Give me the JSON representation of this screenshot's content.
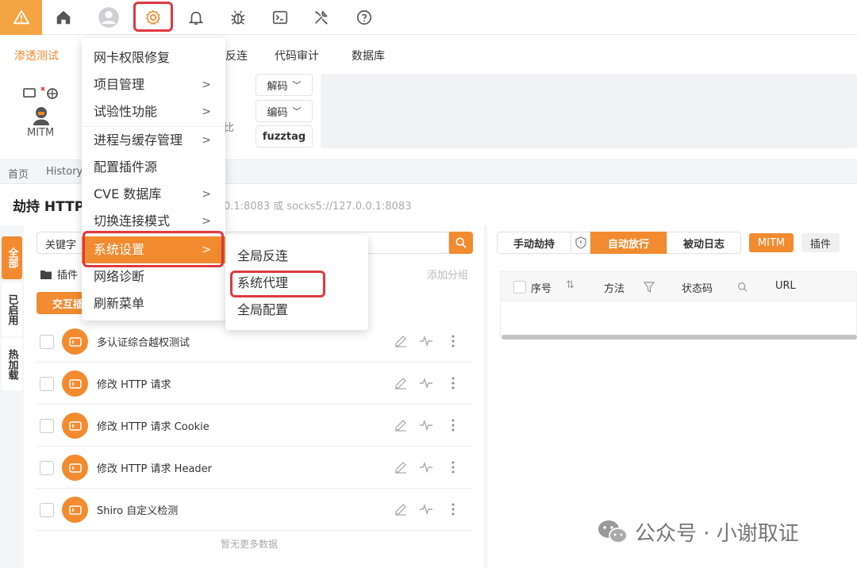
{
  "toolbar": {
    "icons": [
      "warning-icon",
      "home-icon",
      "user-icon",
      "gear-icon",
      "bell-icon",
      "bug-icon",
      "terminal-icon",
      "tools-icon",
      "help-icon"
    ]
  },
  "tabs": [
    "渗透测试",
    "反连",
    "代码审计",
    "数据库"
  ],
  "tools": {
    "mitm_label": "MITM",
    "decode": "解码",
    "encode": "编码",
    "fuzztag": "fuzztag",
    "compare_fragment": "比"
  },
  "breadcrumb": [
    "首页",
    "History"
  ],
  "header": {
    "title": "劫持 HTTP",
    "addr_hint": "0.1:8083 或 socks5://127.0.0.1:8083"
  },
  "vertical_tabs": [
    "全部",
    "已启用",
    "热加载"
  ],
  "left": {
    "search_label": "关键字",
    "folder_label": "插件",
    "add_group": "添加分组",
    "interact_btn": "交互插件",
    "plugins": [
      "多认证综合越权测试",
      "修改 HTTP 请求",
      "修改 HTTP 请求 Cookie",
      "修改 HTTP 请求 Header",
      "Shiro 自定义检测"
    ],
    "no_more": "暂无更多数据"
  },
  "right": {
    "manual_hijack": "手动劫持",
    "auto_release": "自动放行",
    "passive_log": "被动日志",
    "mitm_tag": "MITM",
    "plugin_tag": "插件",
    "columns": [
      "序号",
      "方法",
      "状态码",
      "URL"
    ]
  },
  "menu": {
    "items": [
      {
        "label": "网卡权限修复",
        "arrow": ""
      },
      {
        "label": "项目管理",
        "arrow": ">"
      },
      {
        "label": "试验性功能",
        "arrow": ">"
      },
      {
        "label": "进程与缓存管理",
        "arrow": ">"
      },
      {
        "label": "配置插件源",
        "arrow": ""
      },
      {
        "label": "CVE 数据库",
        "arrow": ">"
      },
      {
        "label": "切换连接模式",
        "arrow": ">"
      },
      {
        "label": "系统设置",
        "arrow": ">"
      },
      {
        "label": "网络诊断",
        "arrow": ""
      },
      {
        "label": "刷新菜单",
        "arrow": ""
      }
    ]
  },
  "submenu": {
    "items": [
      "全局反连",
      "系统代理",
      "全局配置"
    ]
  },
  "watermark": "公众号 · 小谢取证",
  "colors": {
    "accent": "#f28b30",
    "highlight": "#e0383e"
  }
}
